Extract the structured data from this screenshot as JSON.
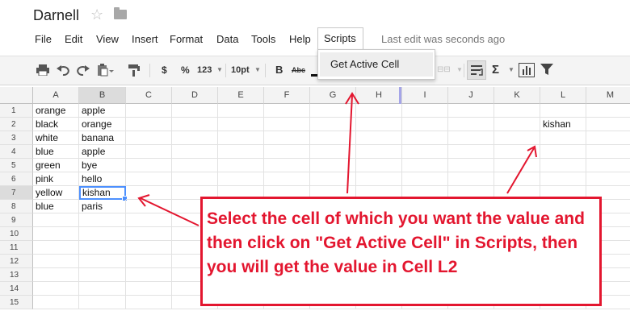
{
  "doc": {
    "title": "Darnell",
    "star_icon": "star-icon",
    "folder_icon": "folder-icon"
  },
  "menu": {
    "items": [
      "File",
      "Edit",
      "View",
      "Insert",
      "Format",
      "Data",
      "Tools",
      "Help"
    ],
    "scripts": "Scripts",
    "last_edit": "Last edit was seconds ago"
  },
  "toolbar": {
    "currency": "$",
    "percent": "%",
    "number_format": "123",
    "font_size": "10pt",
    "bold": "B",
    "strike": "Abc",
    "sum": "Σ"
  },
  "dropdown": {
    "item": "Get Active Cell"
  },
  "sheet": {
    "columns": [
      "A",
      "B",
      "C",
      "D",
      "E",
      "F",
      "G",
      "H",
      "I",
      "J",
      "K",
      "L",
      "M"
    ],
    "rows": [
      "1",
      "2",
      "3",
      "4",
      "5",
      "6",
      "7",
      "8",
      "9",
      "10",
      "11",
      "12",
      "13",
      "14",
      "15"
    ],
    "cells": {
      "A1": "orange",
      "B1": "apple",
      "A2": "black",
      "B2": "orange",
      "L2": "kishan",
      "A3": "white",
      "B3": "banana",
      "A4": "blue",
      "B4": "apple",
      "A5": "green",
      "B5": "bye",
      "A6": "pink",
      "B6": "hello",
      "A7": "yellow",
      "B7": "kishan",
      "A8": "blue",
      "B8": "paris"
    },
    "active_cell": "B7",
    "selection_color": "#4d90fe"
  },
  "callout": {
    "text": "Select the cell of which you want the value and then click on \"Get Active Cell\" in Scripts, then you will get the value in Cell L2",
    "color": "#e3162f"
  }
}
